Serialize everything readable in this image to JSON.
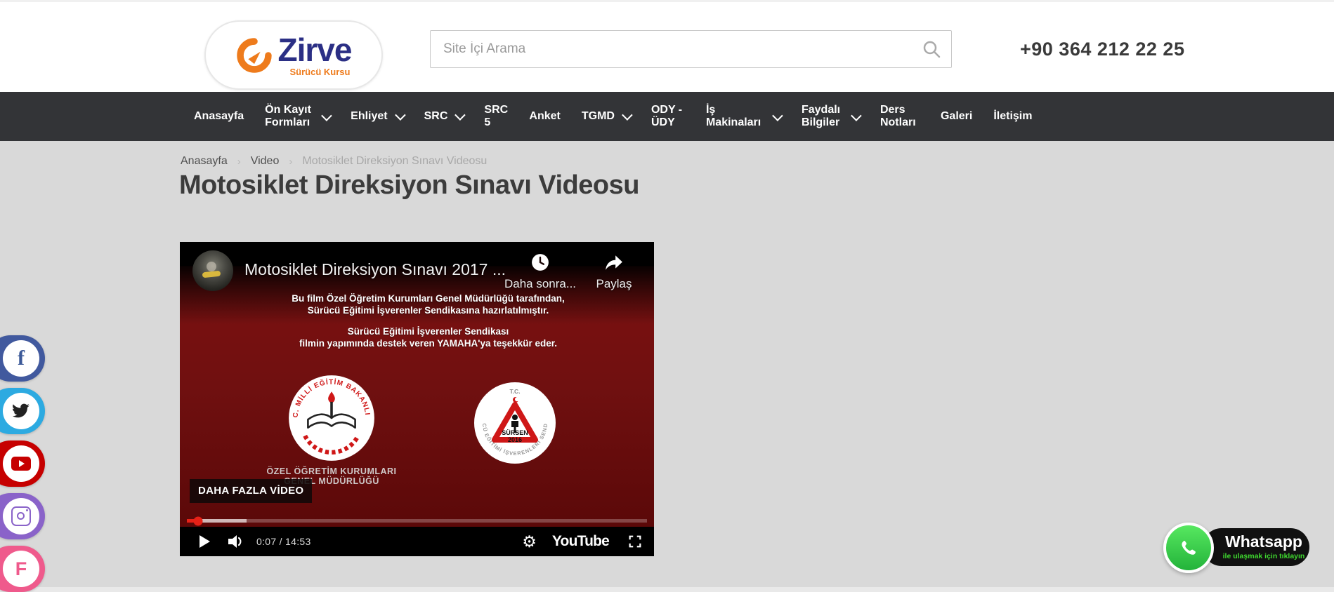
{
  "header": {
    "brand": "Zirve",
    "brand_tagline": "Sürücü Kursu",
    "search_placeholder": "Site İçi Arama",
    "phone": "+90 364 212 22 25"
  },
  "nav": {
    "items": [
      {
        "label": "Anasayfa",
        "dropdown": false
      },
      {
        "label": "Ön Kayıt Formları",
        "dropdown": true
      },
      {
        "label": "Ehliyet",
        "dropdown": true
      },
      {
        "label": "SRC",
        "dropdown": true
      },
      {
        "label": "SRC 5",
        "dropdown": false
      },
      {
        "label": "Anket",
        "dropdown": false
      },
      {
        "label": "TGMD",
        "dropdown": true
      },
      {
        "label": "ODY - ÜDY",
        "dropdown": false
      },
      {
        "label": "İş Makinaları",
        "dropdown": true
      },
      {
        "label": "Faydalı Bilgiler",
        "dropdown": true
      },
      {
        "label": "Ders Notları",
        "dropdown": false
      },
      {
        "label": "Galeri",
        "dropdown": false
      },
      {
        "label": "İletişim",
        "dropdown": false
      }
    ]
  },
  "breadcrumb": {
    "separator": "›",
    "items": [
      "Anasayfa",
      "Video",
      "Motosiklet Direksiyon Sınavı Videosu"
    ]
  },
  "page": {
    "title": "Motosiklet Direksiyon Sınavı Videosu"
  },
  "player": {
    "video_title": "Motosiklet Direksiyon Sınavı 2017 ...",
    "watch_later_label": "Daha sonra...",
    "share_label": "Paylaş",
    "line1": "Bu film Özel Öğretim Kurumları Genel Müdürlüğü tarafından,",
    "line2": "Sürücü Eğitimi İşverenler Sendikasına hazırlatılmıştır.",
    "line3": "Sürücü Eğitimi İşverenler Sendikası",
    "line4": "filmin yapımında destek veren  YAMAHA'ya teşekkür eder.",
    "meb_arc_text": "T.C. MİLLİ EĞİTİM BAKANLIĞI",
    "meb_caption1": "ÖZEL ÖĞRETİM KURUMLARI",
    "meb_caption2": "GENEL MÜDÜRLÜĞÜ",
    "sursen_tc": "T.C.",
    "sursen_arc_text": "SÜRÜCÜ EĞİTİMİ İŞVERENLERİ SENDİKASI",
    "sursen_title": "SÜRSEN",
    "sursen_year": "2016",
    "more_videos_label": "DAHA FAZLA VİDEO",
    "time": "0:07 / 14:53",
    "youtube_label": "YouTube",
    "settings_glyph": "⚙"
  },
  "social": {
    "items": [
      {
        "name": "facebook",
        "color": "#41599e",
        "glyph": "f"
      },
      {
        "name": "twitter",
        "color": "#2caae1",
        "glyph": ""
      },
      {
        "name": "youtube",
        "color": "#c60000",
        "glyph": ""
      },
      {
        "name": "instagram",
        "color": "#8a63c9",
        "glyph": ""
      },
      {
        "name": "foursquare",
        "color": "#ef5a8c",
        "glyph": "F"
      }
    ]
  },
  "whatsapp": {
    "title": "Whatsapp",
    "subtitle": "ile ulaşmak için tıklayın"
  },
  "colors": {
    "nav_bg": "#333437",
    "content_bg": "#d9d9d9",
    "video_maroon": "#701010",
    "brand_navy": "#2b2f85",
    "brand_orange": "#ee7b1c",
    "progress_red": "#e62117",
    "whatsapp_green": "#23b33a"
  }
}
